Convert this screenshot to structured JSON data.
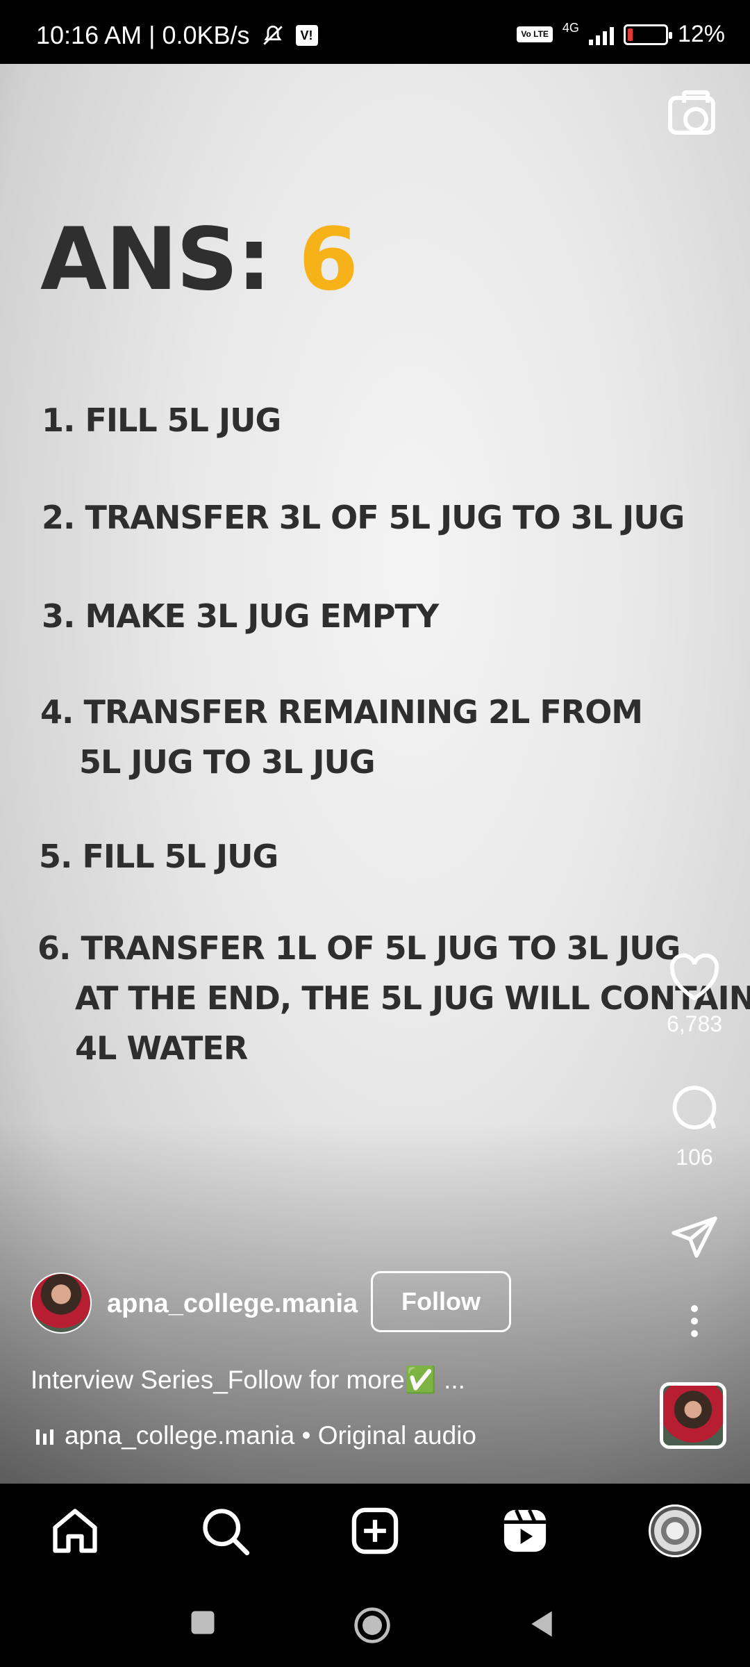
{
  "status_bar": {
    "time_speed": "10:16 AM | 0.0KB/s",
    "carrier_badge": "V!",
    "volte_badge": "Vo LTE",
    "network": "4G",
    "battery": "12%"
  },
  "reel": {
    "ans_label": "ANS:",
    "ans_value": "6",
    "steps": {
      "s1": "1. FILL 5L JUG",
      "s2": "2. TRANSFER 3L OF 5L JUG TO 3L JUG",
      "s3": "3. MAKE 3L JUG EMPTY",
      "s4a": "4. TRANSFER REMAINING 2L FROM",
      "s4b": "5L JUG TO 3L JUG",
      "s5": "5. FILL 5L JUG",
      "s6a": "6. TRANSFER 1L OF 5L JUG TO 3L JUG",
      "s6b": "AT THE END, THE 5L JUG WILL CONTAIN",
      "s6c": "4L WATER"
    }
  },
  "actions": {
    "likes": "6,783",
    "comments": "106"
  },
  "author": {
    "username": "apna_college.mania",
    "follow_label": "Follow"
  },
  "caption": "Interview Series_Follow for more✅ ...",
  "audio": "apna_college.mania • Original audio",
  "nav": {
    "items": [
      "home-icon",
      "search-icon",
      "create-icon",
      "reels-icon",
      "profile-avatar"
    ]
  },
  "colors": {
    "accent": "#f7b21a",
    "title_text": "#2f2f2f"
  }
}
